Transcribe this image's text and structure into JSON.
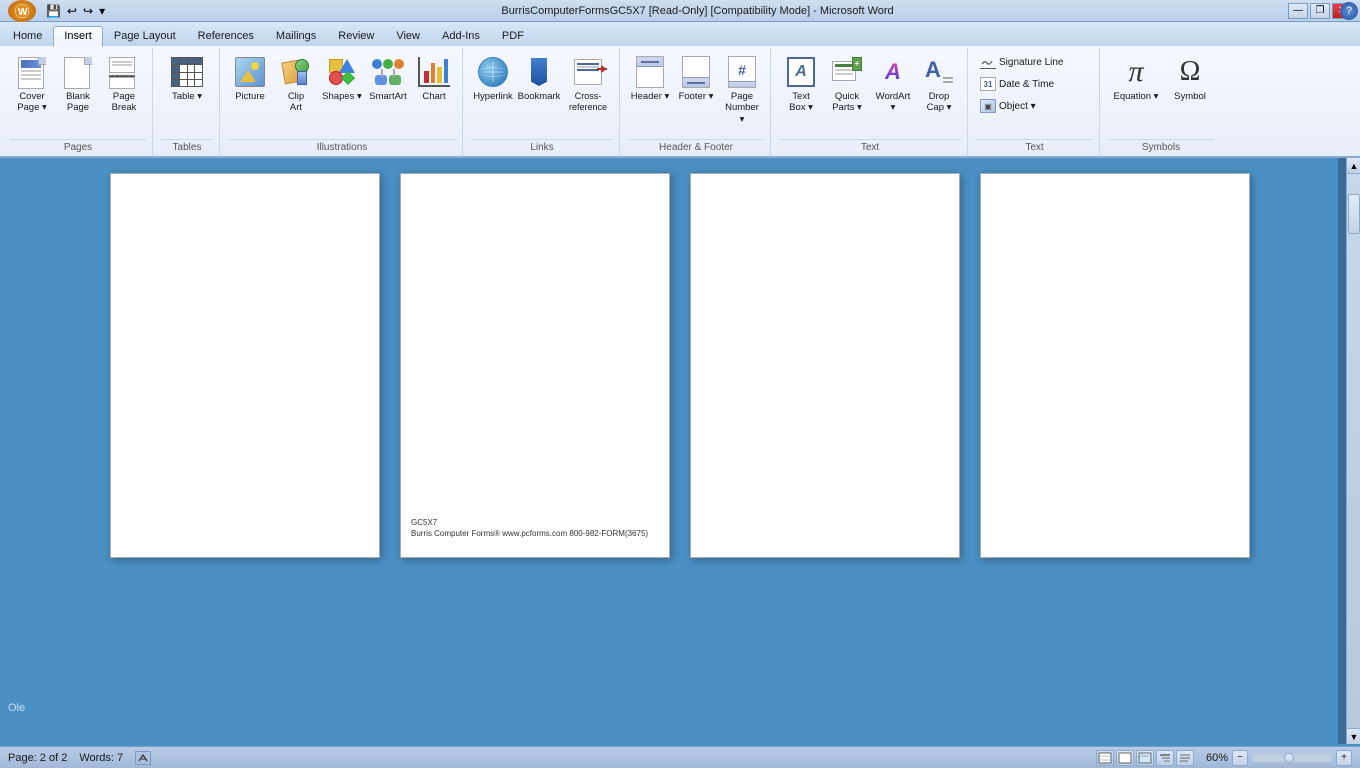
{
  "titlebar": {
    "title": "BurrisComputerFormsGC5X7 [Read-Only] [Compatibility Mode] - Microsoft Word",
    "min_btn": "—",
    "restore_btn": "❐",
    "close_btn": "✕"
  },
  "quickaccess": {
    "save_label": "💾",
    "undo_label": "↩",
    "redo_label": "↪",
    "dropdown_label": "▾"
  },
  "tabs": [
    {
      "id": "home",
      "label": "Home"
    },
    {
      "id": "insert",
      "label": "Insert",
      "active": true
    },
    {
      "id": "pagelayout",
      "label": "Page Layout"
    },
    {
      "id": "references",
      "label": "References"
    },
    {
      "id": "mailings",
      "label": "Mailings"
    },
    {
      "id": "review",
      "label": "Review"
    },
    {
      "id": "view",
      "label": "View"
    },
    {
      "id": "addins",
      "label": "Add-Ins"
    },
    {
      "id": "pdf",
      "label": "PDF"
    }
  ],
  "ribbon": {
    "groups": [
      {
        "id": "pages",
        "label": "Pages",
        "items": [
          {
            "id": "coverpage",
            "label": "Cover\nPage",
            "type": "large",
            "dropdown": true
          },
          {
            "id": "blankpage",
            "label": "Blank\nPage",
            "type": "large"
          },
          {
            "id": "pagebreak",
            "label": "Page\nBreak",
            "type": "large"
          }
        ]
      },
      {
        "id": "tables",
        "label": "Tables",
        "items": [
          {
            "id": "table",
            "label": "Table",
            "type": "large",
            "dropdown": true
          }
        ]
      },
      {
        "id": "illustrations",
        "label": "Illustrations",
        "items": [
          {
            "id": "picture",
            "label": "Picture",
            "type": "large"
          },
          {
            "id": "clipart",
            "label": "Clip\nArt",
            "type": "large"
          },
          {
            "id": "shapes",
            "label": "Shapes",
            "type": "large",
            "dropdown": true
          },
          {
            "id": "smartart",
            "label": "SmartArt",
            "type": "large"
          },
          {
            "id": "chart",
            "label": "Chart",
            "type": "large"
          }
        ]
      },
      {
        "id": "links",
        "label": "Links",
        "items": [
          {
            "id": "hyperlink",
            "label": "Hyperlink",
            "type": "large"
          },
          {
            "id": "bookmark",
            "label": "Bookmark",
            "type": "large"
          },
          {
            "id": "crossref",
            "label": "Cross-reference",
            "type": "large"
          }
        ]
      },
      {
        "id": "headerfooter",
        "label": "Header & Footer",
        "items": [
          {
            "id": "header",
            "label": "Header",
            "type": "large",
            "dropdown": true
          },
          {
            "id": "footer",
            "label": "Footer",
            "type": "large",
            "dropdown": true
          },
          {
            "id": "pagenumber",
            "label": "Page\nNumber",
            "type": "large",
            "dropdown": true
          }
        ]
      },
      {
        "id": "text",
        "label": "Text",
        "items": [
          {
            "id": "textbox",
            "label": "Text\nBox",
            "type": "large",
            "dropdown": true
          },
          {
            "id": "quickparts",
            "label": "Quick\nParts",
            "type": "large",
            "dropdown": true
          },
          {
            "id": "wordart",
            "label": "WordArt",
            "type": "large",
            "dropdown": true
          },
          {
            "id": "dropcap",
            "label": "Drop\nCap",
            "type": "large",
            "dropdown": true
          }
        ]
      },
      {
        "id": "textgroup2",
        "label": "Text",
        "items_right": [
          {
            "id": "signatureline",
            "label": "Signature Line",
            "type": "small",
            "dropdown": true
          },
          {
            "id": "datetime",
            "label": "Date & Time",
            "type": "small"
          },
          {
            "id": "object",
            "label": "Object",
            "type": "small",
            "dropdown": true
          }
        ]
      },
      {
        "id": "symbols",
        "label": "Symbols",
        "items": [
          {
            "id": "equation",
            "label": "Equation",
            "type": "large",
            "dropdown": true
          },
          {
            "id": "symbol",
            "label": "Symbol",
            "type": "large"
          }
        ]
      }
    ]
  },
  "document": {
    "pages": [
      {
        "id": "page1",
        "type": "blank"
      },
      {
        "id": "page2",
        "type": "content",
        "footer_line1": "GC5X7",
        "footer_line2": "Burris Computer Forms® www.pcforms.com 800-982-FORM(3675)"
      },
      {
        "id": "page3",
        "type": "blank"
      },
      {
        "id": "page4",
        "type": "blank"
      }
    ]
  },
  "statusbar": {
    "page_info": "Page: 2 of 2",
    "words": "Words: 7",
    "zoom_level": "60%",
    "ole_text": "Ole"
  }
}
